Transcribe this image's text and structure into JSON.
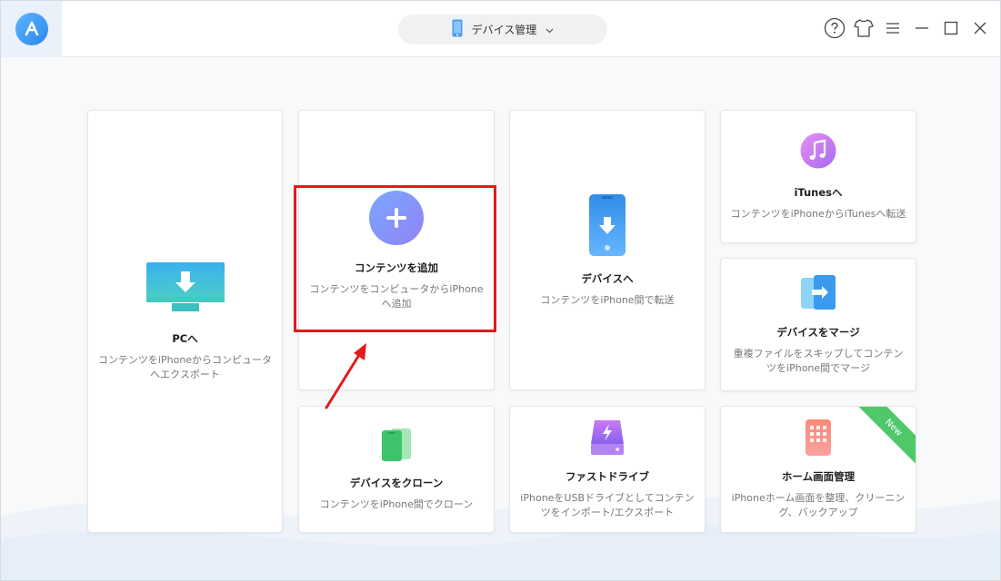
{
  "header": {
    "device_selector_label": "デバイス管理"
  },
  "cards": {
    "to_pc": {
      "title": "PCへ",
      "desc": "コンテンツをiPhoneからコンピュータへエクスポート"
    },
    "add_content": {
      "title": "コンテンツを追加",
      "desc": "コンテンツをコンピュータからiPhoneへ追加"
    },
    "to_device": {
      "title": "デバイスへ",
      "desc": "コンテンツをiPhone間で転送"
    },
    "to_itunes": {
      "title": "iTunesへ",
      "desc": "コンテンツをiPhoneからiTunesへ転送"
    },
    "merge_device": {
      "title": "デバイスをマージ",
      "desc": "重複ファイルをスキップしてコンテンツをiPhone間でマージ"
    },
    "clone_device": {
      "title": "デバイスをクローン",
      "desc": "コンテンツをiPhone間でクローン"
    },
    "fast_drive": {
      "title": "ファストドライブ",
      "desc": "iPhoneをUSBドライブとしてコンテンツをインポート/エクスポート"
    },
    "home_screen": {
      "title": "ホーム画面管理",
      "desc": "iPhoneホーム画面を整理、クリーニング、バックアップ",
      "badge": "New"
    }
  },
  "colors": {
    "highlight_border": "#e21b1b",
    "arrow": "#e21b1b",
    "accent_blue": "#3d8ef0",
    "new_badge": "#4fc86a"
  },
  "icons": [
    "app-logo-icon",
    "iphone-icon",
    "chevron-down-icon",
    "help-icon",
    "skin-icon",
    "menu-icon",
    "minimize-icon",
    "maximize-icon",
    "close-icon",
    "monitor-download-icon",
    "plus-circle-icon",
    "phone-download-icon",
    "music-note-icon",
    "merge-phones-icon",
    "clone-phones-icon",
    "flash-drive-icon",
    "home-screen-icon"
  ]
}
